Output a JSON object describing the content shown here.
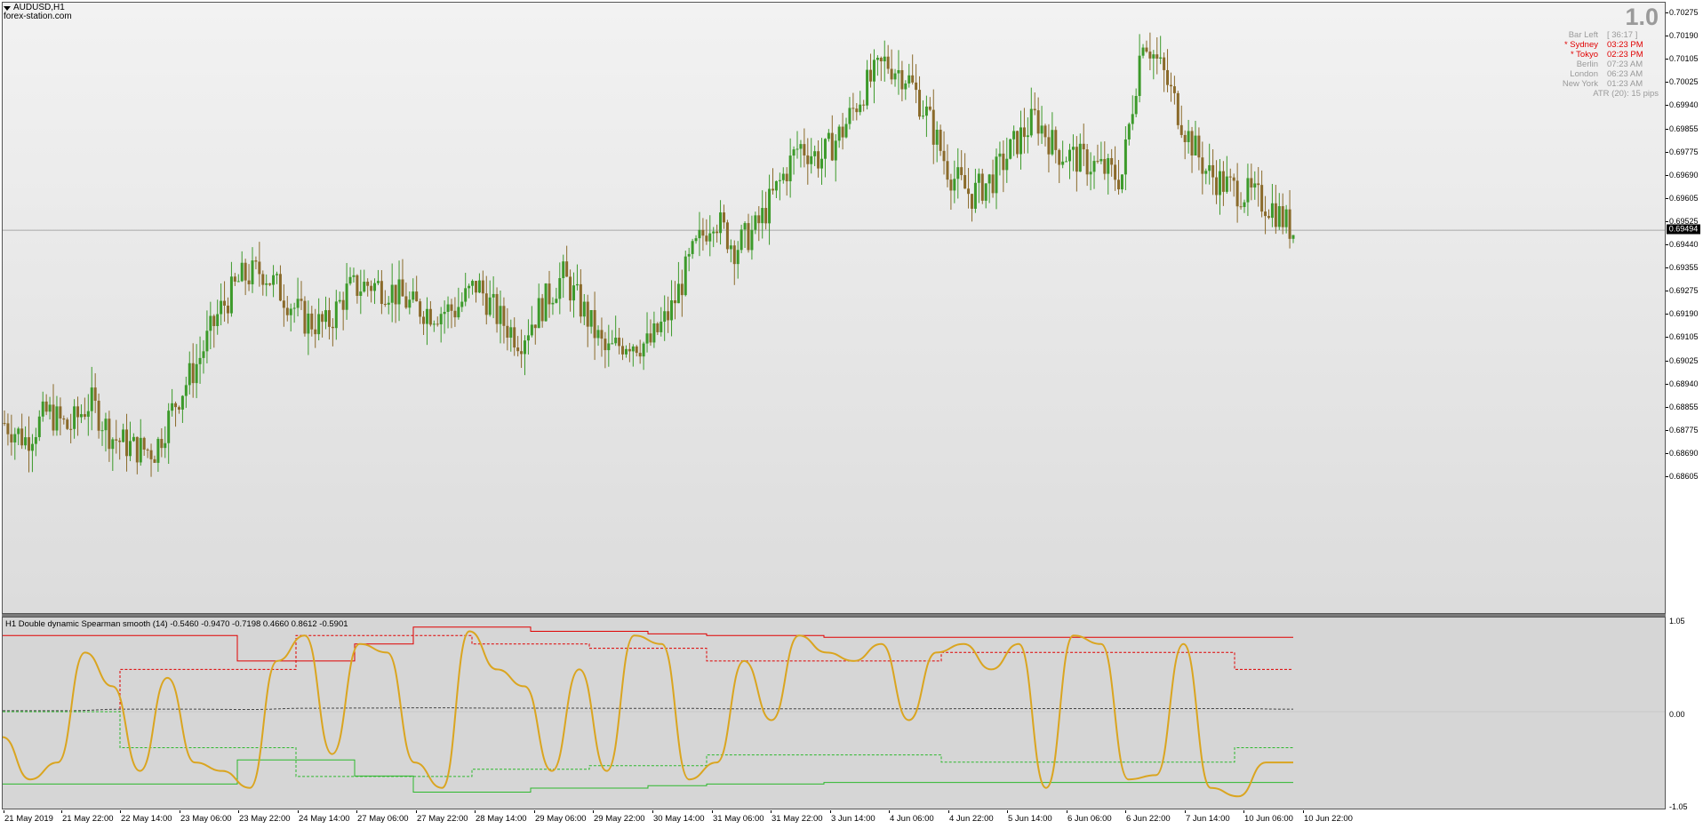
{
  "window": {
    "symbol": "AUDUSD,H1",
    "broker": "forex-station.com"
  },
  "info_panel": {
    "number": "1.0",
    "rows": [
      {
        "label": "Bar Left",
        "value": "[ 36:17 ]",
        "color": "gray"
      },
      {
        "label": "* Sydney",
        "value": "03:23 PM",
        "color": "red"
      },
      {
        "label": "* Tokyo",
        "value": "02:23 PM",
        "color": "red"
      },
      {
        "label": "Berlin",
        "value": "07:23 AM",
        "color": "gray"
      },
      {
        "label": "London",
        "value": "06:23 AM",
        "color": "gray"
      },
      {
        "label": "New York",
        "value": "01:23 AM",
        "color": "gray"
      },
      {
        "label": "ATR (20): 15 pips",
        "value": "",
        "color": "gray"
      }
    ]
  },
  "indicator": {
    "title": "H1 Double dynamic Spearman smooth (14) -0.5460 -0.9470 -0.7198 0.4660 0.8612 -0.5901",
    "levels": [
      "1.05",
      "0.00",
      "-1.05"
    ]
  },
  "price_axis": {
    "labels": [
      "0.70275",
      "0.70190",
      "0.70105",
      "0.70025",
      "0.69940",
      "0.69855",
      "0.69775",
      "0.69690",
      "0.69605",
      "0.69525",
      "0.69440",
      "0.69355",
      "0.69275",
      "0.69190",
      "0.69105",
      "0.69025",
      "0.68940",
      "0.68855",
      "0.68775",
      "0.68690",
      "0.68605"
    ],
    "current_price": "0.69494"
  },
  "time_axis": {
    "labels": [
      "21 May 2019",
      "21 May 22:00",
      "22 May 14:00",
      "23 May 06:00",
      "23 May 22:00",
      "24 May 14:00",
      "27 May 06:00",
      "27 May 22:00",
      "28 May 14:00",
      "29 May 06:00",
      "29 May 22:00",
      "30 May 14:00",
      "31 May 06:00",
      "31 May 22:00",
      "3 Jun 14:00",
      "4 Jun 06:00",
      "4 Jun 22:00",
      "5 Jun 14:00",
      "6 Jun 06:00",
      "6 Jun 22:00",
      "7 Jun 14:00",
      "10 Jun 06:00",
      "10 Jun 22:00"
    ]
  },
  "colors": {
    "bull_candle": "#3c9a2a",
    "bear_candle": "#8a6a2a",
    "spearman_line": "#daa520",
    "upper_band": "#e00000",
    "lower_band": "#2db82d",
    "mid_band": "#444444"
  },
  "chart_data": {
    "type": "line",
    "price_series_anchors": [
      0.688,
      0.6874,
      0.6884,
      0.6878,
      0.6888,
      0.6875,
      0.6871,
      0.687,
      0.6888,
      0.6902,
      0.692,
      0.6932,
      0.6935,
      0.6926,
      0.6917,
      0.6915,
      0.6928,
      0.693,
      0.6928,
      0.6922,
      0.692,
      0.6921,
      0.693,
      0.6918,
      0.691,
      0.6922,
      0.6933,
      0.692,
      0.6905,
      0.691,
      0.6908,
      0.692,
      0.694,
      0.6955,
      0.6943,
      0.695,
      0.6965,
      0.698,
      0.6975,
      0.6985,
      0.7,
      0.701,
      0.7005,
      0.699,
      0.697,
      0.6962,
      0.6968,
      0.698,
      0.699,
      0.6978,
      0.6975,
      0.6972,
      0.6968,
      0.702,
      0.7005,
      0.6985,
      0.697,
      0.6965,
      0.6962,
      0.6958,
      0.6949
    ],
    "indicator_series": {
      "spearman": [
        -0.3,
        -0.8,
        -0.6,
        0.7,
        0.3,
        -0.7,
        0.4,
        -0.6,
        -0.7,
        -0.9,
        0.6,
        0.9,
        -0.5,
        0.8,
        0.7,
        -0.6,
        -0.9,
        0.95,
        0.5,
        0.3,
        -0.7,
        0.5,
        -0.7,
        0.9,
        0.8,
        -0.8,
        -0.6,
        0.6,
        -0.1,
        0.9,
        0.7,
        0.6,
        0.8,
        -0.1,
        0.7,
        0.8,
        0.5,
        0.8,
        -0.9,
        0.9,
        0.8,
        -0.8,
        -0.75,
        0.8,
        -0.9,
        -1.0,
        -0.6,
        -0.6
      ],
      "upper_solid": [
        0.9,
        0.9,
        0.9,
        0.9,
        0.6,
        0.6,
        0.8,
        1.0,
        1.0,
        0.95,
        0.95,
        0.92,
        0.9,
        0.9,
        0.88,
        0.88,
        0.88,
        0.88,
        0.88,
        0.88,
        0.88,
        0.88
      ],
      "upper_dashed": [
        0.0,
        0.0,
        0.5,
        0.5,
        0.5,
        0.9,
        0.9,
        0.9,
        0.8,
        0.8,
        0.75,
        0.75,
        0.6,
        0.6,
        0.6,
        0.6,
        0.7,
        0.7,
        0.7,
        0.7,
        0.7,
        0.5
      ]
    }
  }
}
